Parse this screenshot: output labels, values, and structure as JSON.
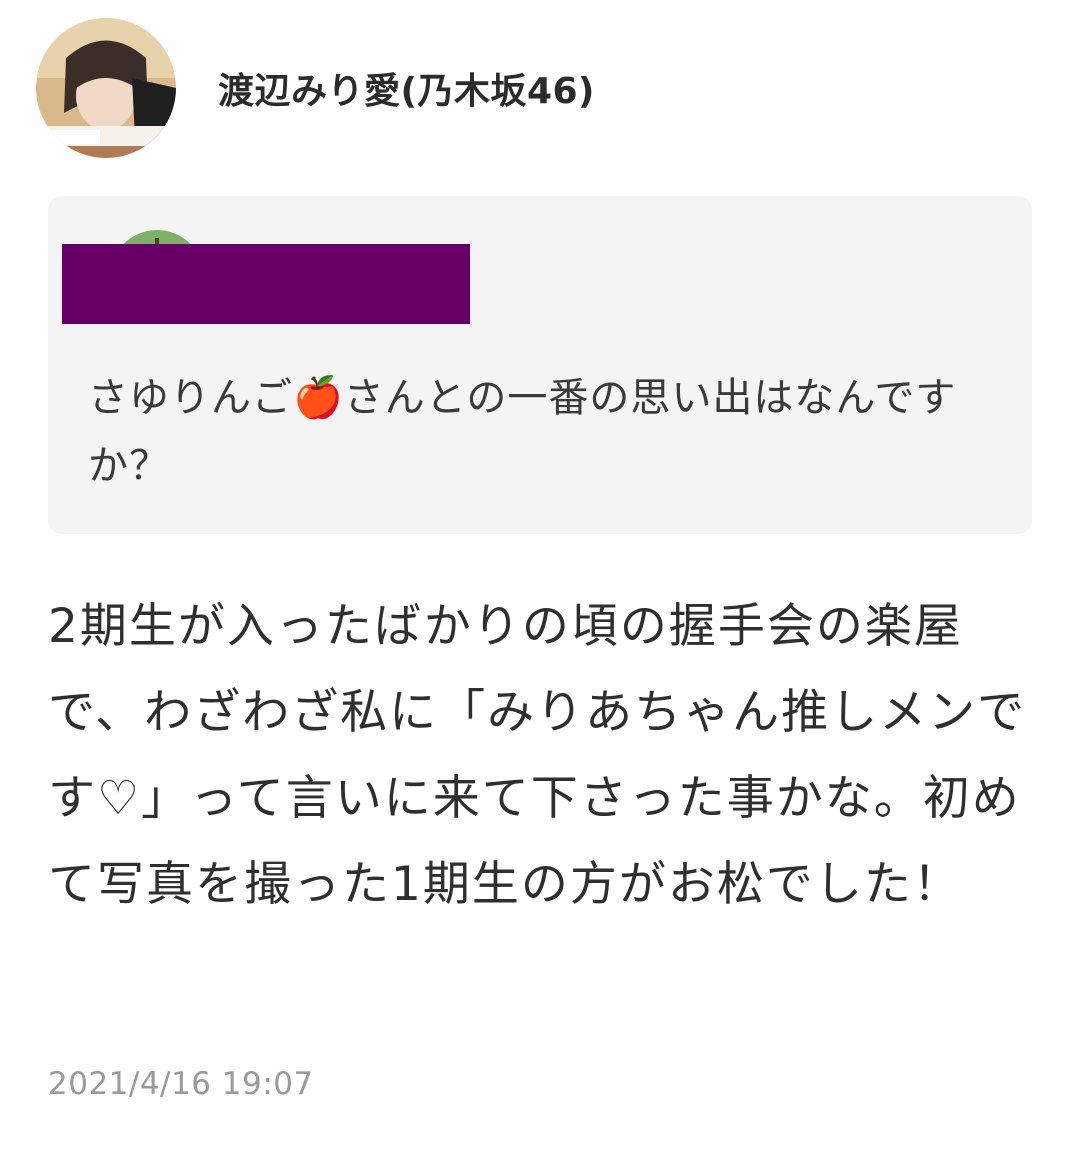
{
  "author": {
    "name": "渡辺みり愛(乃木坂46)",
    "avatar_icon": "user-photo-avatar"
  },
  "question": {
    "asker_avatar_icon": "apple-avatar",
    "redaction_color": "#660066",
    "text": "さゆりんご🍎さんとの一番の思い出はなんですか？"
  },
  "answer": {
    "text": "2期生が入ったばかりの頃の握手会の楽屋で、わざわざ私に「みりあちゃん推しメンです♡」って言いに来て下さった事かな。初めて写真を撮った1期生の方がお松でした！"
  },
  "timestamp": "2021/4/16 19:07",
  "colors": {
    "card_background": "#f4f4f4",
    "text_primary": "#2f2f2f",
    "text_muted": "#9a9a9a"
  }
}
